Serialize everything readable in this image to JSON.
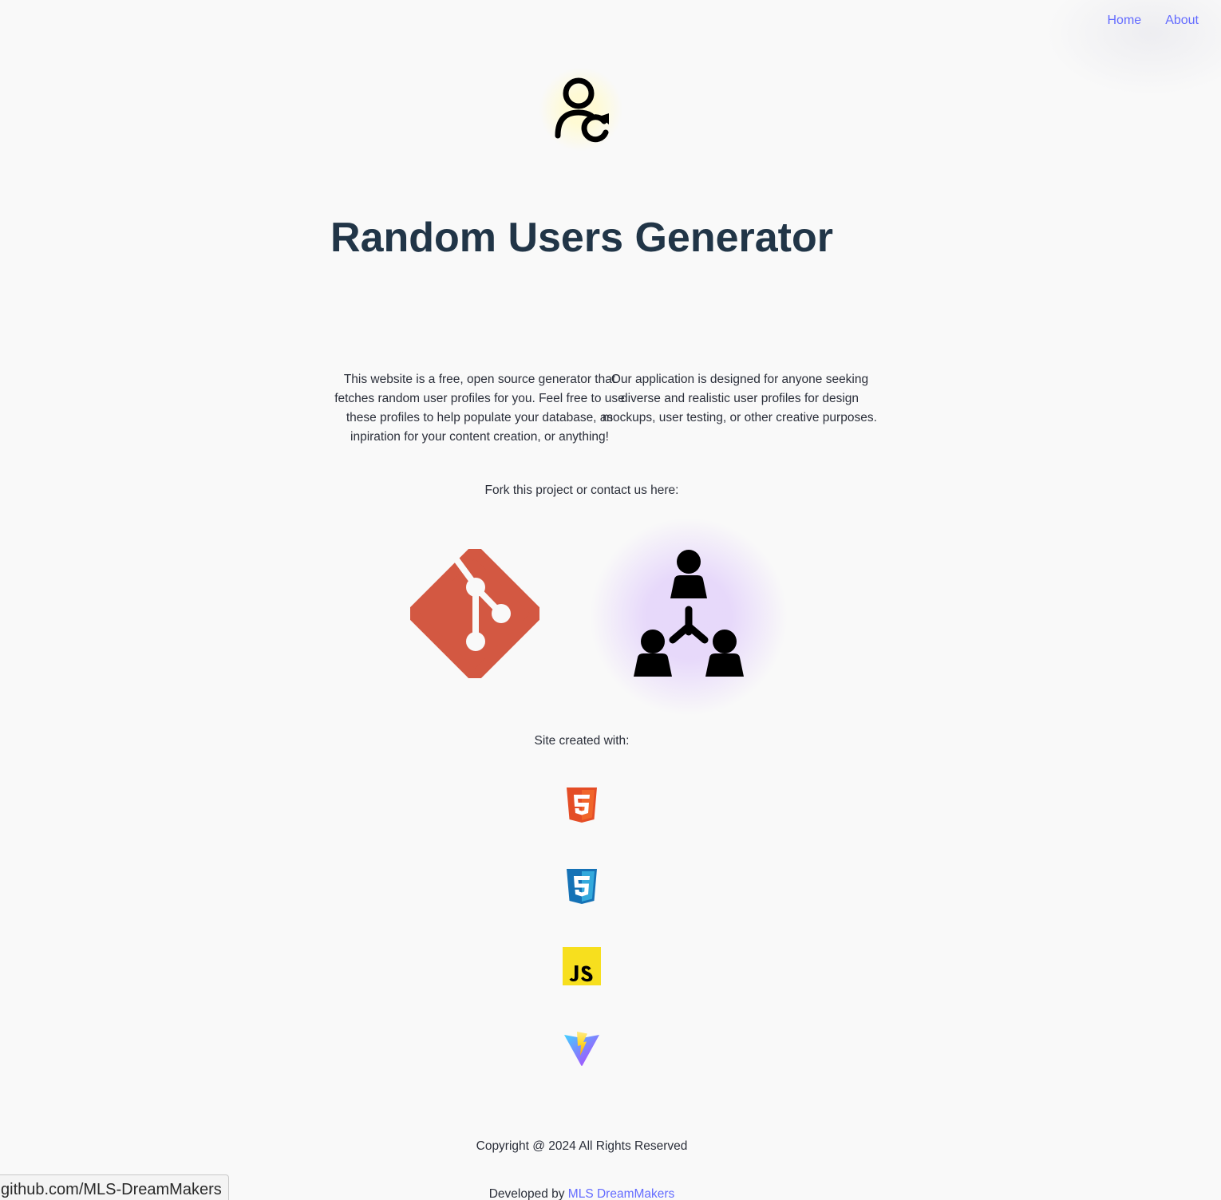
{
  "nav": {
    "home_label": "Home",
    "about_label": "About"
  },
  "header": {
    "title": "Random Users Generator",
    "logo_icon": "user-refresh-icon"
  },
  "about": {
    "left_text": "This website is a free, open source generator that fetches random user profiles for you. Feel free to use these profiles to help populate your database, as inpiration for your content creation, or anything!",
    "right_text": "Our application is designed for anyone seeking diverse and realistic user profiles for design mockups, user testing, or other creative purposes."
  },
  "links": {
    "heading": "Fork this project or contact us here:",
    "items": [
      {
        "icon": "git-icon"
      },
      {
        "icon": "team-icon"
      }
    ]
  },
  "tech": {
    "heading": "Site created with:",
    "items": [
      {
        "icon": "html5-icon",
        "color": "#e44d26"
      },
      {
        "icon": "css3-icon",
        "color": "#1572b6"
      },
      {
        "icon": "javascript-icon",
        "color": "#f7df1e"
      },
      {
        "icon": "vite-icon",
        "color": "#646cff"
      }
    ]
  },
  "footer": {
    "copyright": "Copyright @ 2024 All Rights Reserved",
    "developed_prefix": "Developed by ",
    "developer_name": "MLS DreamMakers"
  },
  "status_bar": {
    "url": "github.com/MLS-DreamMakers"
  },
  "colors": {
    "accent": "#646cff",
    "title": "#213547",
    "git": "#d35842",
    "background": "#f9f9f9"
  }
}
